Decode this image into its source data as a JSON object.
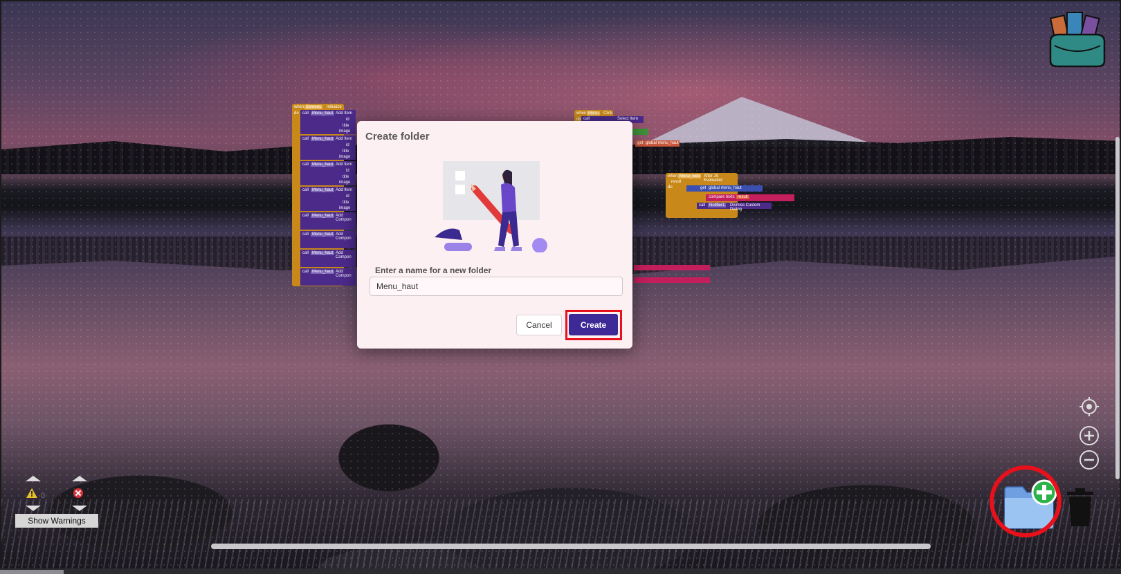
{
  "dialog": {
    "title": "Create folder",
    "field_label": "Enter a name for a new folder",
    "folder_name_value": "Menu_haut",
    "cancel_label": "Cancel",
    "create_label": "Create"
  },
  "warnings": {
    "warning_count": "0",
    "show_warnings_label": "Show Warnings"
  },
  "blocks": {
    "left_event": {
      "when": "when",
      "component": "Screen1",
      "event": "Initialize",
      "do": "do"
    },
    "left_calls": [
      {
        "call": "call",
        "component": "Menu_haut",
        "method": "Add Item",
        "params": [
          "id",
          "title",
          "image"
        ]
      },
      {
        "call": "call",
        "component": "Menu_haut",
        "method": "Add Item",
        "params": [
          "id",
          "title",
          "image"
        ]
      },
      {
        "call": "call",
        "component": "Menu_haut",
        "method": "Add Item",
        "params": [
          "id",
          "title",
          "image"
        ]
      },
      {
        "call": "call",
        "component": "Menu_haut",
        "method": "Add Item",
        "params": [
          "id",
          "title",
          "image"
        ]
      },
      {
        "call": "call",
        "component": "Menu_haut",
        "method": "Add Compon",
        "params": []
      },
      {
        "call": "call",
        "component": "Menu_haut",
        "method": "Add Compon",
        "params": []
      },
      {
        "call": "call",
        "component": "Menu_haut",
        "method": "Add Compon",
        "params": []
      },
      {
        "call": "call",
        "component": "Menu_haut",
        "method": "Add Compon",
        "params": []
      }
    ],
    "right_event": {
      "when": "when",
      "component": "Menu",
      "event": "Click",
      "do": "do",
      "call": "call",
      "method": "Select Item",
      "get": "get",
      "global": "global menu_haut"
    },
    "right_event2": {
      "when": "when",
      "component": "Menu_web",
      "event": "After JS Evaluated",
      "result": "result",
      "do": "do",
      "if": "if",
      "get": "get",
      "global": "global menu_haut",
      "then": "then",
      "compare": "compare texts",
      "result2": "result",
      "call": "call",
      "component2": "Notifier1",
      "method": "Dismiss Custom Dialog"
    }
  },
  "icons": {
    "backpack": "backpack-icon",
    "recenter": "crosshair-icon",
    "zoom_in": "zoom-in-icon",
    "zoom_out": "zoom-out-icon",
    "new_folder": "folder-add-icon",
    "trash": "trash-icon",
    "warning": "warning-icon",
    "error": "error-icon"
  },
  "colors": {
    "create_button": "#3e2a97",
    "highlight": "#e8101a",
    "dialog_bg": "#fdf0f3"
  }
}
